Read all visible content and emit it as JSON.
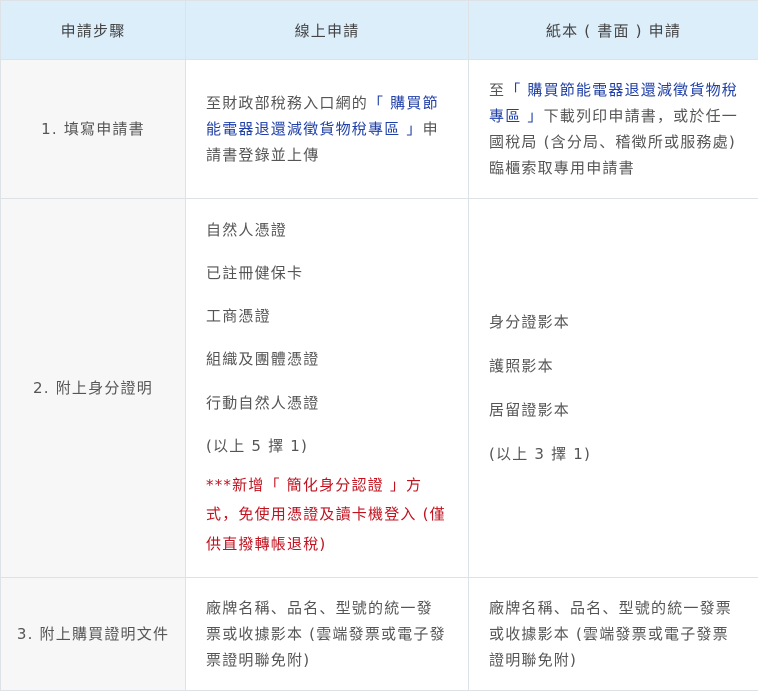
{
  "headers": [
    "申請步驟",
    "線上申請",
    "紙本 ( 書面 ) 申請"
  ],
  "row1": {
    "step": "1. 填寫申請書",
    "online": {
      "pre": "至財政部稅務入口網的",
      "link": "「 購買節能電器退還減徵貨物稅專區 」",
      "post": "申請書登錄並上傳"
    },
    "paper": {
      "pre": "至",
      "link": "「 購買節能電器退還減徵貨物稅專區 」",
      "post": "下載列印申請書，或於任一國稅局 (含分局、稽徵所或服務處) 臨櫃索取專用申請書"
    }
  },
  "row2": {
    "step": "2. 附上身分證明",
    "online_items": [
      "自然人憑證",
      "已註冊健保卡",
      "工商憑證",
      "組織及團體憑證",
      "行動自然人憑證",
      "(以上 5 擇 1)"
    ],
    "online_note": "***新增「 簡化身分認證 」方式，免使用憑證及讀卡機登入 (僅供直撥轉帳退稅)",
    "paper_items": [
      "身分證影本",
      "護照影本",
      "居留證影本",
      "(以上 3 擇 1)"
    ]
  },
  "row3": {
    "step": "3. 附上購買證明文件",
    "online": "廠牌名稱、品名、型號的統一發票或收據影本 (雲端發票或電子發票證明聯免附)",
    "paper": "廠牌名稱、品名、型號的統一發票或收據影本 (雲端發票或電子發票證明聯免附)"
  }
}
